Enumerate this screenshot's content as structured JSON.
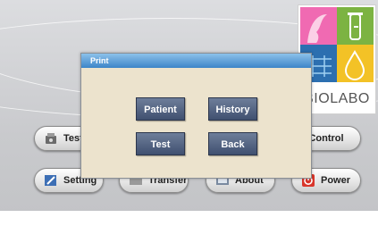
{
  "brand": {
    "logo_text": "BIOLABO"
  },
  "main_buttons": [
    {
      "label": "Test",
      "icon": "test-icon"
    },
    {
      "label": "Control",
      "icon": ""
    },
    {
      "label": "Setting",
      "icon": "settings-icon"
    },
    {
      "label": "Transfer",
      "icon": "transfer-icon"
    },
    {
      "label": "About",
      "icon": "about-icon"
    },
    {
      "label": "Power",
      "icon": "power-icon"
    }
  ],
  "dialog": {
    "title": "Print",
    "buttons": {
      "patient": "Patient",
      "history": "History",
      "test": "Test",
      "back": "Back"
    }
  },
  "colors": {
    "dialog_bg": "#ece3cd",
    "title_bar": "#3d85c8",
    "dialog_button": "#4a5a78"
  }
}
